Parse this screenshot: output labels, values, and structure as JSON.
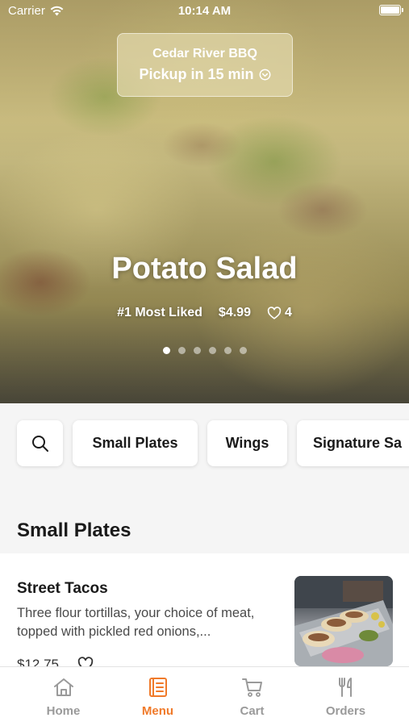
{
  "status_bar": {
    "carrier": "Carrier",
    "time": "10:14 AM"
  },
  "pickup": {
    "restaurant_name": "Cedar River BBQ",
    "pickup_text": "Pickup in 15 min"
  },
  "hero": {
    "title": "Potato Salad",
    "badge": "#1 Most Liked",
    "price": "$4.99",
    "likes": "4",
    "carousel_total": 6,
    "carousel_active": 0
  },
  "categories": {
    "search_icon": "search-icon",
    "items": [
      {
        "label": "Small Plates"
      },
      {
        "label": "Wings"
      },
      {
        "label": "Signature Sa"
      }
    ]
  },
  "menu_section": {
    "title": "Small Plates",
    "items": [
      {
        "name": "Street Tacos",
        "description": "Three flour tortillas, your choice of meat, topped with pickled red onions,...",
        "price": "$12.75"
      }
    ]
  },
  "tab_bar": {
    "active_color": "#f07a2a",
    "inactive_color": "#9a9a9a",
    "tabs": [
      {
        "label": "Home",
        "icon": "home-icon"
      },
      {
        "label": "Menu",
        "icon": "menu-book-icon"
      },
      {
        "label": "Cart",
        "icon": "cart-icon"
      },
      {
        "label": "Orders",
        "icon": "fork-knife-icon"
      }
    ],
    "active_tab": "Menu"
  }
}
